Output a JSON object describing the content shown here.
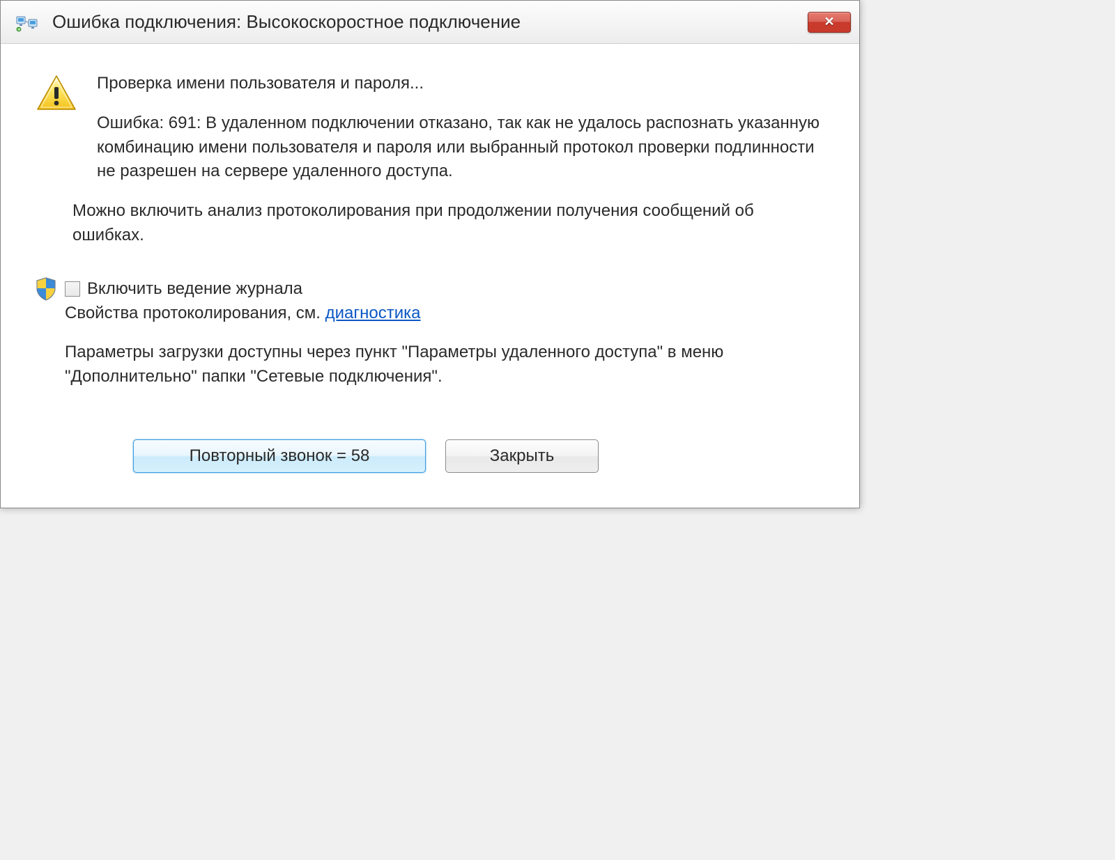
{
  "title": "Ошибка подключения: Высокоскоростное подключение",
  "main": {
    "checking_text": "Проверка имени пользователя и пароля...",
    "error_text": "Ошибка: 691: В удаленном подключении отказано, так как не удалось распознать указанную комбинацию имени пользователя и пароля или выбранный протокол проверки подлинности не разрешен на сервере удаленного доступа.",
    "hint_text": "Можно включить анализ протоколирования при продолжении получения сообщений об ошибках."
  },
  "log": {
    "checkbox_label": "Включить ведение журнала",
    "props_prefix": "Свойства протоколирования, см. ",
    "diag_link": "диагностика",
    "upload_params": "Параметры загрузки доступны через пункт \"Параметры удаленного доступа\" в меню \"Дополнительно\" папки \"Сетевые подключения\"."
  },
  "buttons": {
    "redial": "Повторный звонок = 58",
    "close": "Закрыть"
  }
}
